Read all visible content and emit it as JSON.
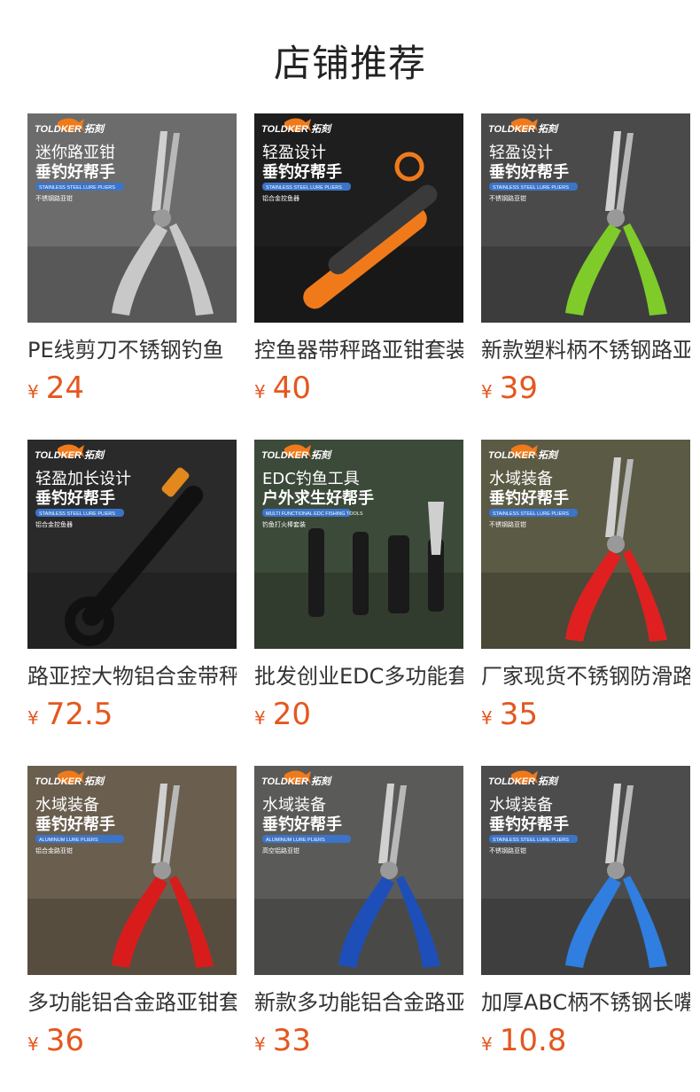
{
  "header": {
    "title": "店铺推荐"
  },
  "brand": {
    "logo_text": "TOLDKER",
    "logo_cn": "拓刻"
  },
  "colors": {
    "price": "#e4571f",
    "text": "#333333",
    "title": "#222222",
    "accent_fish": "#f07a1a"
  },
  "products": [
    {
      "name": "PE线剪刀不锈钢钓鱼",
      "currency": "¥",
      "price": "24",
      "banner": {
        "line1": "迷你路亚钳",
        "line2": "垂钓好帮手",
        "tag": "STAINLESS STEEL LURE PLIERS",
        "note": "不锈钢路亚钳"
      },
      "bg": "#6c6c6c",
      "accent": "#c8c8c8"
    },
    {
      "name": "控鱼器带秤路亚钳套装",
      "currency": "¥",
      "price": "40",
      "banner": {
        "line1": "轻盈设计",
        "line2": "垂钓好帮手",
        "tag": "STAINLESS STEEL LURE PLIERS",
        "note": "铝合金控鱼器"
      },
      "bg": "#1e1e1e",
      "accent": "#f07a1a"
    },
    {
      "name": "新款塑料柄不锈钢路亚钳",
      "currency": "¥",
      "price": "39",
      "banner": {
        "line1": "轻盈设计",
        "line2": "垂钓好帮手",
        "tag": "STAINLESS STEEL LURE PLIERS",
        "note": "不锈钢路亚钳"
      },
      "bg": "#4a4a4a",
      "accent": "#7ecb2a"
    },
    {
      "name": "路亚控大物铝合金带秤",
      "currency": "¥",
      "price": "72.5",
      "banner": {
        "line1": "轻盈加长设计",
        "line2": "垂钓好帮手",
        "tag": "STAINLESS STEEL LURE PLIERS",
        "note": "铝合金控鱼器"
      },
      "bg": "#2a2a2a",
      "accent": "#e2881d"
    },
    {
      "name": "批发创业EDC多功能套装",
      "currency": "¥",
      "price": "20",
      "banner": {
        "line1": "EDC钓鱼工具",
        "line2": "户外求生好帮手",
        "tag": "MULTI FUNCTIONAL EDC FISHING TOOLS",
        "note": "钓鱼打火棒套装"
      },
      "bg": "#3c4a3a",
      "accent": "#1a1a1a"
    },
    {
      "name": "厂家现货不锈钢防滑路",
      "currency": "¥",
      "price": "35",
      "banner": {
        "line1": "水域装备",
        "line2": "垂钓好帮手",
        "tag": "STAINLESS STEEL LURE PLIERS",
        "note": "不锈钢路亚钳"
      },
      "bg": "#5b5a44",
      "accent": "#e02020"
    },
    {
      "name": "多功能铝合金路亚钳套",
      "currency": "¥",
      "price": "36",
      "banner": {
        "line1": "水域装备",
        "line2": "垂钓好帮手",
        "tag": "ALUMINUM LURE PLIERS",
        "note": "铝合金路亚钳"
      },
      "bg": "#6a5e4e",
      "accent": "#d81c1c"
    },
    {
      "name": "新款多功能铝合金路亚",
      "currency": "¥",
      "price": "33",
      "banner": {
        "line1": "水域装备",
        "line2": "垂钓好帮手",
        "tag": "ALUMINUM LURE PLIERS",
        "note": "高空铝路亚钳"
      },
      "bg": "#5a5a58",
      "accent": "#1e4fb8"
    },
    {
      "name": "加厚ABC柄不锈钢长嘴",
      "currency": "¥",
      "price": "10.8",
      "banner": {
        "line1": "水域装备",
        "line2": "垂钓好帮手",
        "tag": "STAINLESS STEEL LURE PLIERS",
        "note": "不锈钢路亚钳"
      },
      "bg": "#4c4c4c",
      "accent": "#2f7ee0"
    }
  ]
}
